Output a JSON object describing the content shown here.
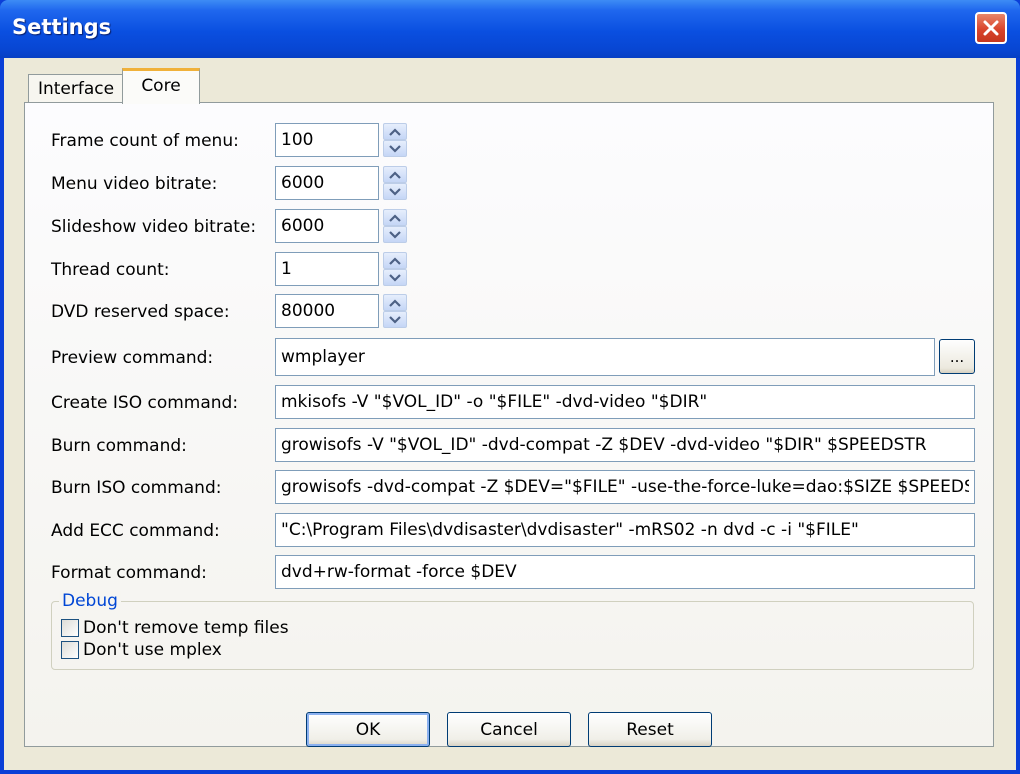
{
  "window": {
    "title": "Settings"
  },
  "tabs": [
    {
      "label": "Interface",
      "selected": false
    },
    {
      "label": "Core",
      "selected": true
    }
  ],
  "spin_fields": [
    {
      "label": "Frame count of menu:",
      "value": "100"
    },
    {
      "label": "Menu video bitrate:",
      "value": "6000"
    },
    {
      "label": "Slideshow video bitrate:",
      "value": "6000"
    },
    {
      "label": "Thread count:",
      "value": "1"
    },
    {
      "label": "DVD reserved space:",
      "value": "80000"
    }
  ],
  "commands": {
    "preview": {
      "label": "Preview command:",
      "value": "wmplayer",
      "browse_label": "..."
    },
    "create_iso": {
      "label": "Create ISO command:",
      "value": "mkisofs -V \"$VOL_ID\" -o \"$FILE\" -dvd-video \"$DIR\""
    },
    "burn": {
      "label": "Burn command:",
      "value": "growisofs -V \"$VOL_ID\" -dvd-compat -Z $DEV -dvd-video \"$DIR\" $SPEEDSTR"
    },
    "burn_iso": {
      "label": "Burn ISO command:",
      "value": "growisofs -dvd-compat -Z $DEV=\"$FILE\" -use-the-force-luke=dao:$SIZE $SPEEDSTR"
    },
    "add_ecc": {
      "label": "Add ECC command:",
      "value": "\"C:\\Program Files\\dvdisaster\\dvdisaster\" -mRS02 -n dvd -c -i \"$FILE\""
    },
    "format": {
      "label": "Format command:",
      "value": "dvd+rw-format -force $DEV"
    }
  },
  "debug": {
    "title": "Debug",
    "options": [
      {
        "label": "Don't remove temp files",
        "checked": false
      },
      {
        "label": "Don't use mplex",
        "checked": false
      }
    ]
  },
  "buttons": {
    "ok": "OK",
    "cancel": "Cancel",
    "reset": "Reset"
  },
  "colors": {
    "title_bar": "#0a4fe0",
    "dialog_bg": "#ece9d8",
    "accent_tab": "#f0b13a",
    "group_title": "#0046d5",
    "close_button": "#d9452c"
  }
}
